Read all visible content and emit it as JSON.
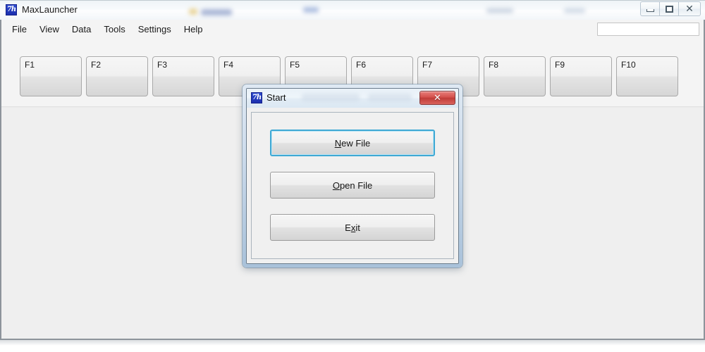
{
  "window": {
    "title": "MaxLauncher",
    "icon": "app-logo-icon",
    "icon_glyph": "7h",
    "controls": {
      "minimize_label": "Minimize",
      "maximize_label": "Maximize",
      "close_label": "Close",
      "close_glyph": "✕"
    }
  },
  "menubar": {
    "items": [
      {
        "label": "File"
      },
      {
        "label": "View"
      },
      {
        "label": "Data"
      },
      {
        "label": "Tools"
      },
      {
        "label": "Settings"
      },
      {
        "label": "Help"
      }
    ],
    "search": {
      "value": "",
      "placeholder": ""
    }
  },
  "fkeys": {
    "buttons": [
      {
        "label": "F1"
      },
      {
        "label": "F2"
      },
      {
        "label": "F3"
      },
      {
        "label": "F4"
      },
      {
        "label": "F5"
      },
      {
        "label": "F6"
      },
      {
        "label": "F7"
      },
      {
        "label": "F8"
      },
      {
        "label": "F9"
      },
      {
        "label": "F10"
      }
    ]
  },
  "dialog": {
    "title": "Start",
    "icon": "app-logo-icon",
    "icon_glyph": "7h",
    "close_glyph": "✕",
    "buttons": [
      {
        "label": "New File",
        "accel_before": "",
        "accel": "N",
        "accel_after": "ew File",
        "focused": true
      },
      {
        "label": "Open File",
        "accel_before": "",
        "accel": "O",
        "accel_after": "pen File",
        "focused": false
      },
      {
        "label": "Exit",
        "accel_before": "E",
        "accel": "x",
        "accel_after": "it",
        "focused": false
      }
    ]
  },
  "colors": {
    "accent_focus": "#3fa9d4",
    "close_red": "#c03c38",
    "app_icon_blue": "#1c2fae",
    "window_chrome": "#f4f4f4",
    "workspace": "#efefef"
  }
}
